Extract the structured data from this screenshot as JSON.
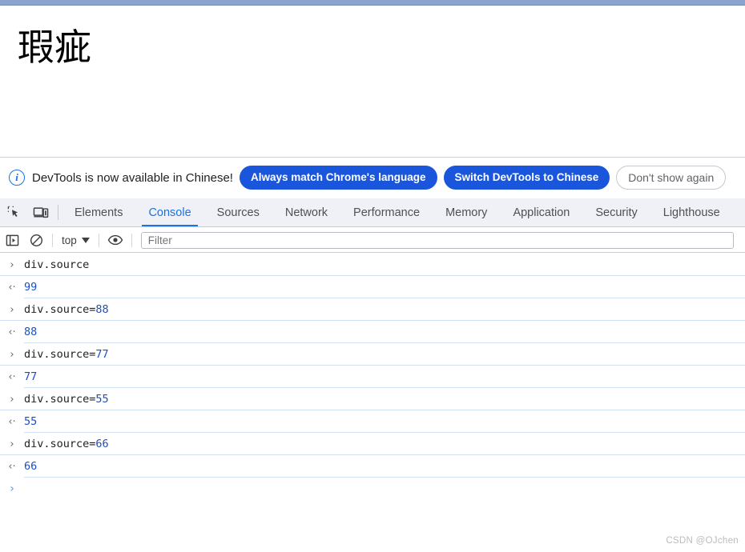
{
  "window": {
    "top_strip_color": "#8ba4ce"
  },
  "page": {
    "heading": "瑕疵"
  },
  "banner": {
    "icon": "info-circle-icon",
    "icon_glyph": "i",
    "message": "DevTools is now available in Chinese!",
    "buttons": [
      {
        "label": "Always match Chrome's language",
        "style": "primary"
      },
      {
        "label": "Switch DevTools to Chinese",
        "style": "primary"
      },
      {
        "label": "Don't show again",
        "style": "ghost"
      }
    ]
  },
  "devtools": {
    "left_icons": [
      {
        "name": "inspect-element-icon"
      },
      {
        "name": "device-toolbar-icon"
      }
    ],
    "tabs": [
      {
        "label": "Elements",
        "active": false
      },
      {
        "label": "Console",
        "active": true
      },
      {
        "label": "Sources",
        "active": false
      },
      {
        "label": "Network",
        "active": false
      },
      {
        "label": "Performance",
        "active": false
      },
      {
        "label": "Memory",
        "active": false
      },
      {
        "label": "Application",
        "active": false
      },
      {
        "label": "Security",
        "active": false
      },
      {
        "label": "Lighthouse",
        "active": false
      }
    ],
    "active_tab": "Console",
    "accent_color": "#1a73e8"
  },
  "console_toolbar": {
    "sidebar_icon": "show-console-sidebar-icon",
    "clear_icon": "clear-console-icon",
    "context_label": "top",
    "context_caret": "chevron-down-icon",
    "eye_icon": "live-expression-eye-icon",
    "filter": {
      "value": "",
      "placeholder": "Filter"
    }
  },
  "console_log": {
    "input_arrow": "›",
    "output_arrow": "‹·",
    "prompt_arrow": "›",
    "entries": [
      {
        "kind": "input",
        "pre": "div.source",
        "num": ""
      },
      {
        "kind": "output",
        "pre": "",
        "num": "99"
      },
      {
        "kind": "input",
        "pre": "div.source=",
        "num": "88"
      },
      {
        "kind": "output",
        "pre": "",
        "num": "88"
      },
      {
        "kind": "input",
        "pre": "div.source=",
        "num": "77"
      },
      {
        "kind": "output",
        "pre": "",
        "num": "77"
      },
      {
        "kind": "input",
        "pre": "div.source=",
        "num": "55"
      },
      {
        "kind": "output",
        "pre": "",
        "num": "55"
      },
      {
        "kind": "input",
        "pre": "div.source=",
        "num": "66"
      },
      {
        "kind": "output",
        "pre": "",
        "num": "66"
      }
    ]
  },
  "watermark": {
    "text": "CSDN @OJchen"
  }
}
